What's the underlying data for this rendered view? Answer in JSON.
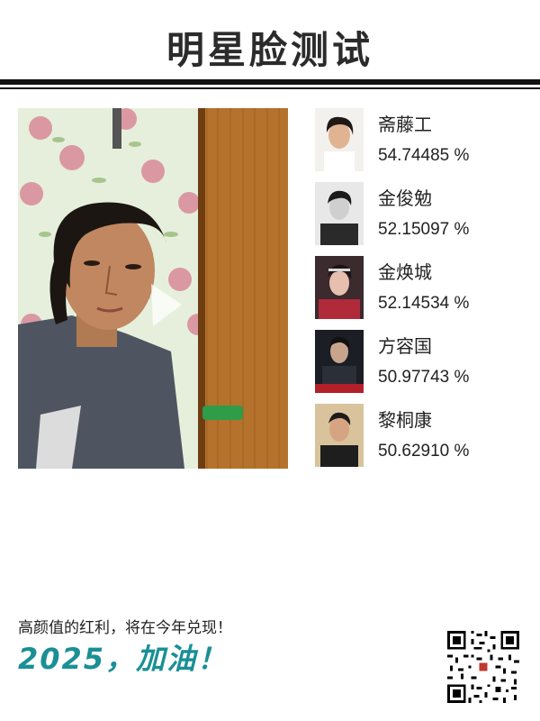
{
  "title": "明星脸测试",
  "matches": [
    {
      "name": "斋藤工",
      "score": "54.74485 %",
      "avatar_icon": "celebrity-portrait"
    },
    {
      "name": "金俊勉",
      "score": "52.15097 %",
      "avatar_icon": "celebrity-portrait"
    },
    {
      "name": "金焕城",
      "score": "52.14534 %",
      "avatar_icon": "celebrity-portrait"
    },
    {
      "name": "方容国",
      "score": "50.97743 %",
      "avatar_icon": "celebrity-portrait"
    },
    {
      "name": "黎桐康",
      "score": "50.62910 %",
      "avatar_icon": "celebrity-portrait"
    }
  ],
  "footer": {
    "tagline": "高颜值的红利，将在今年兑现！",
    "slogan": "2025，加油！"
  },
  "colors": {
    "title": "#2b2b2b",
    "rule": "#111111",
    "slogan": "#1a8f96"
  }
}
